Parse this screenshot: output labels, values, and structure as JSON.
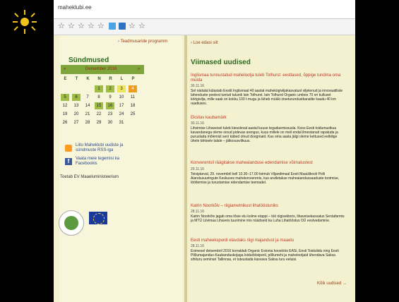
{
  "browser": {
    "title": "maheklubi.ee"
  },
  "toolbar": {
    "icons": [
      "star",
      "star",
      "star",
      "star",
      "star",
      "pin",
      "bookmark",
      "star",
      "star"
    ]
  },
  "sidebar": {
    "program_link": "Teadmusaride programm",
    "events_title": "Sündmused",
    "calendar": {
      "month": "Detsember 2016",
      "prev": "«",
      "next": "»",
      "dow": [
        "E",
        "T",
        "K",
        "N",
        "R",
        "L",
        "P"
      ],
      "weeks": [
        [
          "",
          "",
          "",
          "1",
          "2",
          "3",
          "4"
        ],
        [
          "5",
          "6",
          "7",
          "8",
          "9",
          "10",
          "11"
        ],
        [
          "12",
          "13",
          "14",
          "15",
          "16",
          "17",
          "18"
        ],
        [
          "19",
          "20",
          "21",
          "22",
          "23",
          "24",
          "25"
        ],
        [
          "26",
          "27",
          "28",
          "29",
          "30",
          "31",
          ""
        ]
      ]
    },
    "rss_text": "Liitu Maheklubi uudiste ja sündmuste RSS-iga",
    "fb_text": "Vaata meie tegemisi ka Facebookis",
    "support_text": "Toetab EV Maaeluministeerium"
  },
  "main": {
    "read_more": "Loe edasi siit",
    "news_title": "Viimased uudised",
    "news": [
      {
        "title": "Inglismaa tunnustatud mahelootja tuleb Tolhurst: eestlased, õppige tundma oma mulda",
        "date": "30.11.16",
        "body": "Sel nädalal külastab Eestit Inglismaal 40 aastat mahekögiviljakasvatust viljelenud ja innovaatiliste lahenduste poolest tuntud talunik Iain Tolhurst. Iain Tolhurst Organic umbes 70 ori kulluset köögivilja, mille saak on kokku 100 t mugu ja läheb müüki otseturundustkanalite kaudu 40 km raadiuses."
      },
      {
        "title": "Eksitav kaubamärk",
        "date": "30.11.16",
        "body": "Lihvimise Lihaveisel tuleb kiesoleval aastal kuuse teguduemissusla. Koos Eesti toidumustkuu kavandanega oleme oinud pidevas arengus, kuus millele on meil endal ilmestanud rapatuda ja purustada mõlemist seni käbed olnud doogmaid. Kas oma aasta jälgi oleme kettused eelkilige ühele tähtsele talale – jälkosusvilkuus."
      },
      {
        "title": "Konverentsil räägitakse maheaianduse edendamise võimalustest",
        "date": "29.11.16",
        "body": "Teisipäeval, 29. novembril kell 10.30–17.00 toimub Viljandimaal Eesti Maaülikooli Polli Aiandusuuringute Keskuses mahekonverents, kus arutletakse maheaiandussaaduste tootmise, töötlemise ja turustamise edendamise teemadel."
      },
      {
        "title": "Katrin Noorkõiv – riigiametnikust lihatööstuniks",
        "date": "28.11.16",
        "body": "Katrin Noorkõiv jagab oma tõsie elu kolme etappi – töö riigisektoris, lihaveisekasvatus Sentafarmis ja MTÜ Liivimaa Lihaveis tuurimine mis nüüdseid ka Luha Lihatööstus OÜ eestvedamine."
      },
      {
        "title": "Eesti maheekspordi elavdaks riigi majandust ja maaelu",
        "date": "28.11.16",
        "body": "Esimesel detsembril 2016 korraldab Organic Estonia koostöös EASi, Eesti Toiduliidu ning Eesti Põllumajandus-Kaubanduskojaga loidutööstperil, põllumehi ja mahetootjaid ühendava Saksa sihituru seminari Tallinnas, et tutvustada kasvava Saksa turu eeluisi."
      }
    ],
    "all_news": "Kõik uudised"
  }
}
